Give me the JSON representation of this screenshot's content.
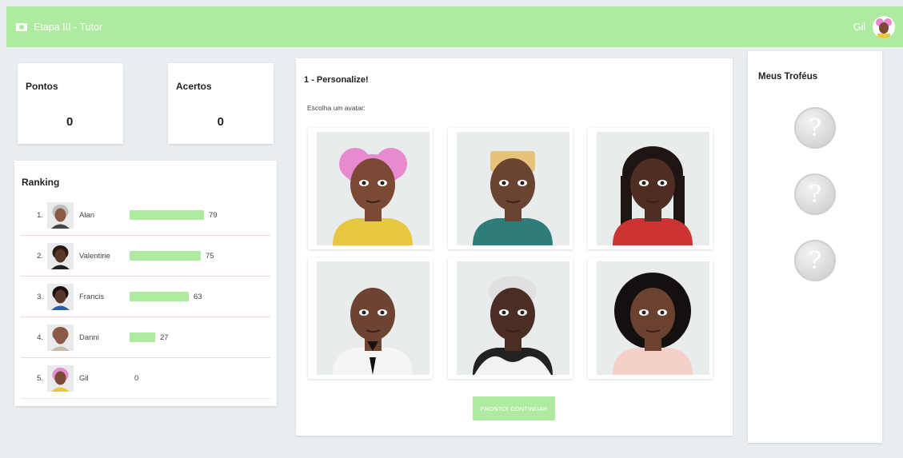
{
  "header": {
    "title": "Etapa III - Tutor",
    "user_name": "Gil",
    "accent_color": "#aeeba0"
  },
  "stats": {
    "pontos": {
      "label": "Pontos",
      "value": "0"
    },
    "acertos": {
      "label": "Acertos",
      "value": "0"
    }
  },
  "ranking": {
    "title": "Ranking",
    "items": [
      {
        "position": "1.",
        "name": "Alan",
        "score": "79",
        "progress": 79,
        "avatar": "elder-gray-hair"
      },
      {
        "position": "2.",
        "name": "Valentine",
        "score": "75",
        "progress": 75,
        "avatar": "man-suit"
      },
      {
        "position": "3.",
        "name": "Francis",
        "score": "63",
        "progress": 63,
        "avatar": "man-dreadlocks"
      },
      {
        "position": "4.",
        "name": "Danni",
        "score": "27",
        "progress": 27,
        "avatar": "bald-man"
      },
      {
        "position": "5.",
        "name": "Gil",
        "score": "0",
        "progress": 0,
        "avatar": "woman-pink-hair"
      }
    ]
  },
  "personalize": {
    "title": "1 - Personalize!",
    "subtitle": "Escolha um avatar:",
    "avatars": [
      {
        "id": "woman-pink-buns",
        "skin": "#7a4a35",
        "hair": "#e88ad0",
        "shirt": "#e8c840"
      },
      {
        "id": "man-blond-flat",
        "skin": "#6b4333",
        "hair": "#e6c27a",
        "shirt": "#2e7d7a"
      },
      {
        "id": "woman-braids",
        "skin": "#4e2e22",
        "hair": "#1e1412",
        "shirt": "#c33"
      },
      {
        "id": "bald-man-goatee",
        "skin": "#6d4432",
        "hair": "#6d4432",
        "shirt": "#f5f5f5"
      },
      {
        "id": "man-white-hair-fur",
        "skin": "#4a2e24",
        "hair": "#e0e0e0",
        "shirt": "#222"
      },
      {
        "id": "woman-curly-afro",
        "skin": "#6b4230",
        "hair": "#141010",
        "shirt": "#f4d0c6"
      }
    ],
    "continue_label": "PRONTO! CONTINUAR"
  },
  "trophies": {
    "title": "Meus Troféus",
    "items": [
      "?",
      "?",
      "?"
    ]
  }
}
